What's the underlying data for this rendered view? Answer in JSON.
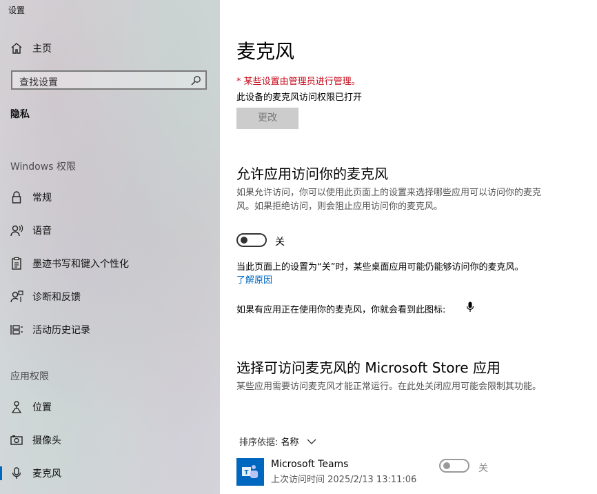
{
  "window_title": "设置",
  "sidebar": {
    "home_label": "主页",
    "search_placeholder": "查找设置",
    "section_privacy": "隐私",
    "section_windows": "Windows 权限",
    "windows_items": [
      {
        "label": "常规",
        "icon": "lock-icon"
      },
      {
        "label": "语音",
        "icon": "speech-icon"
      },
      {
        "label": "墨迹书写和键入个性化",
        "icon": "clipboard-icon"
      },
      {
        "label": "诊断和反馈",
        "icon": "feedback-icon"
      },
      {
        "label": "活动历史记录",
        "icon": "activity-history-icon"
      }
    ],
    "section_app": "应用权限",
    "app_items": [
      {
        "label": "位置",
        "icon": "location-icon"
      },
      {
        "label": "摄像头",
        "icon": "camera-icon"
      },
      {
        "label": "麦克风",
        "icon": "microphone-icon",
        "selected": true
      }
    ]
  },
  "main": {
    "title": "麦克风",
    "managed_notice": "* 某些设置由管理员进行管理。",
    "device_status": "此设备的麦克风访问权限已打开",
    "change_button": "更改",
    "allow_heading": "允许应用访问你的麦克风",
    "allow_desc": "如果允许访问，你可以使用此页面上的设置来选择哪些应用可以访问你的麦克风。如果拒绝访问，则会阻止应用访问你的麦克风。",
    "allow_toggle_label": "关",
    "allow_toggle_on": false,
    "desktop_note": "当此页面上的设置为“关”时，某些桌面应用可能仍能够访问你的麦克风。",
    "learn_more": "了解原因",
    "icon_note": "如果有应用正在使用你的麦克风，你就会看到此图标:",
    "store_heading": "选择可访问麦克风的 Microsoft Store 应用",
    "store_desc": "某些应用需要访问麦克风才能正常运行。在此处关闭应用可能会限制其功能。",
    "sort_label": "排序依据: ",
    "sort_value": "名称",
    "apps": [
      {
        "name": "Microsoft Teams",
        "last_access": "上次访问时间 2025/2/13 13:11:06",
        "toggle_label": "关",
        "toggle_on": false,
        "icon": "teams-icon"
      }
    ]
  },
  "colors": {
    "accent": "#0067c0",
    "warning": "#c50f1f"
  }
}
